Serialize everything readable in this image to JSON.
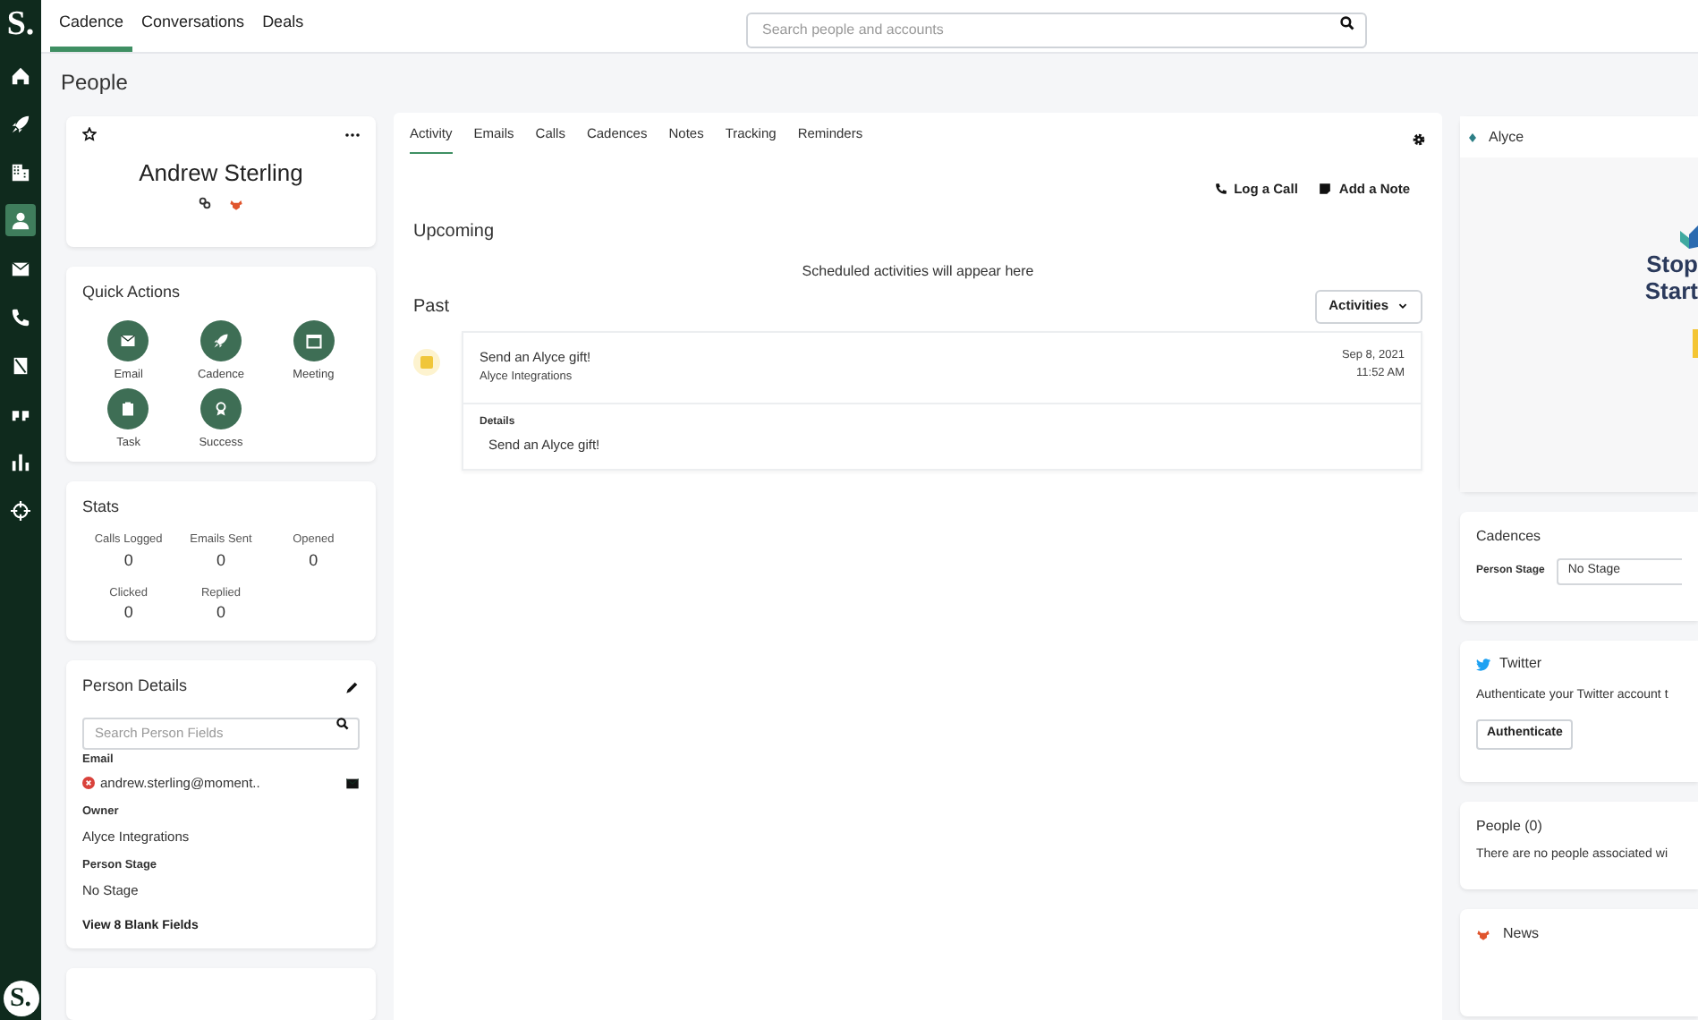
{
  "sidebar": {
    "logo": "S.",
    "items": [
      {
        "kind": "home",
        "selected": false
      },
      {
        "kind": "rocket",
        "selected": false
      },
      {
        "kind": "building",
        "selected": false
      },
      {
        "kind": "person",
        "selected": true
      },
      {
        "kind": "mail",
        "selected": false
      },
      {
        "kind": "phone",
        "selected": false
      },
      {
        "kind": "document",
        "selected": false
      },
      {
        "kind": "quote",
        "selected": false
      },
      {
        "kind": "chart",
        "selected": false
      },
      {
        "kind": "target",
        "selected": false
      }
    ],
    "bottom_logo": "S."
  },
  "top_tabs": [
    {
      "label": "Cadence",
      "selected": true
    },
    {
      "label": "Conversations",
      "selected": false
    },
    {
      "label": "Deals",
      "selected": false
    }
  ],
  "search": {
    "placeholder": "Search people and accounts"
  },
  "page_title": "People",
  "profile": {
    "name": "Andrew Sterling"
  },
  "quick_actions": {
    "title": "Quick Actions",
    "items": [
      {
        "label": "Email",
        "kind": "mail"
      },
      {
        "label": "Cadence",
        "kind": "rocket"
      },
      {
        "label": "Meeting",
        "kind": "calendar"
      },
      {
        "label": "Task",
        "kind": "clipboard"
      },
      {
        "label": "Success",
        "kind": "award"
      }
    ]
  },
  "stats": {
    "title": "Stats",
    "items": [
      {
        "label": "Calls Logged",
        "value": "0"
      },
      {
        "label": "Emails Sent",
        "value": "0"
      },
      {
        "label": "Opened",
        "value": "0"
      },
      {
        "label": "Clicked",
        "value": "0"
      },
      {
        "label": "Replied",
        "value": "0"
      }
    ]
  },
  "person_details": {
    "title": "Person Details",
    "search_placeholder": "Search Person Fields",
    "fields": [
      {
        "label": "Email",
        "value": "andrew.sterling@moment..",
        "kind": "email"
      },
      {
        "label": "Owner",
        "value": "Alyce Integrations",
        "kind": "text"
      },
      {
        "label": "Person Stage",
        "value": "No Stage",
        "kind": "text"
      }
    ],
    "link": "View 8 Blank Fields"
  },
  "activity": {
    "tabs": [
      {
        "label": "Activity",
        "selected": true
      },
      {
        "label": "Emails",
        "selected": false
      },
      {
        "label": "Calls",
        "selected": false
      },
      {
        "label": "Cadences",
        "selected": false
      },
      {
        "label": "Notes",
        "selected": false
      },
      {
        "label": "Tracking",
        "selected": false
      },
      {
        "label": "Reminders",
        "selected": false
      }
    ],
    "actions": [
      {
        "label": "Log a Call",
        "kind": "phone"
      },
      {
        "label": "Add a Note",
        "kind": "note"
      }
    ],
    "upcoming": {
      "title": "Upcoming",
      "empty": "Scheduled activities will appear here"
    },
    "past": {
      "title": "Past",
      "filter": "Activities",
      "items": [
        {
          "title": "Send an Alyce gift!",
          "subtitle": "Alyce Integrations",
          "date": "Sep 8, 2021",
          "time": "11:52 AM",
          "details_label": "Details",
          "details": "Send an Alyce gift!"
        }
      ]
    }
  },
  "alyce": {
    "title": "Alyce",
    "headline": [
      "Stop",
      "Start"
    ]
  },
  "cadences": {
    "title": "Cadences",
    "field_label": "Person Stage",
    "value": "No Stage"
  },
  "twitter": {
    "title": "Twitter",
    "text": "Authenticate your Twitter account t",
    "button": "Authenticate"
  },
  "people": {
    "title": "People (0)",
    "text": "There are no people associated wi"
  },
  "news": {
    "title": "News"
  }
}
